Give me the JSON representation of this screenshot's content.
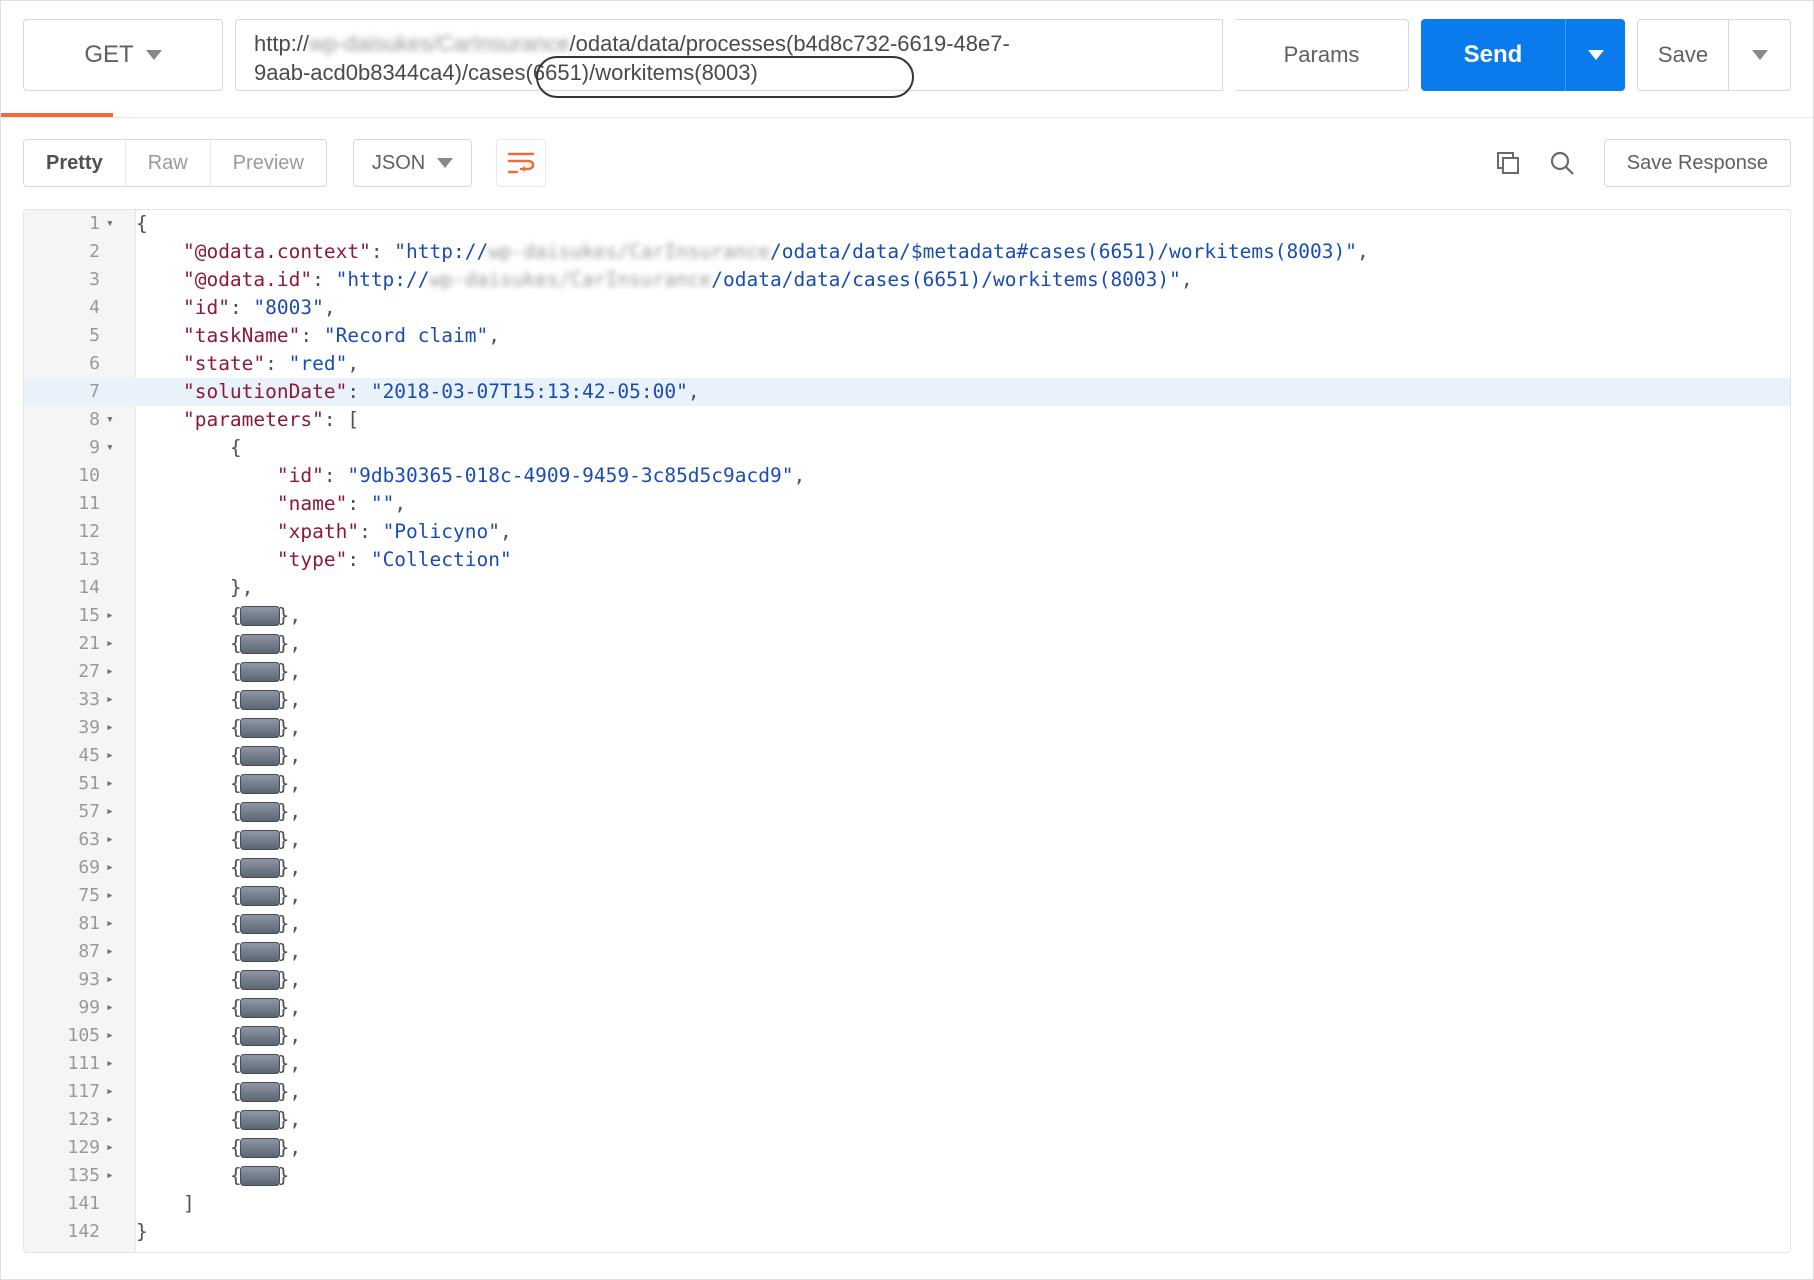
{
  "request": {
    "method": "GET",
    "url_line1_prefix": "http://",
    "url_line1_blurred": "wp-daisukes/CarInsurance",
    "url_line1_suffix": "/odata/data/processes(b4d8c732-6619-48e7-",
    "url_line2": "9aab-acd0b8344ca4)/cases(6651)/workitems(8003)",
    "params_label": "Params",
    "send_label": "Send",
    "save_label": "Save"
  },
  "response_bar": {
    "tab_pretty": "Pretty",
    "tab_raw": "Raw",
    "tab_preview": "Preview",
    "format": "JSON",
    "save_response": "Save Response"
  },
  "code": {
    "brace_open": "{",
    "brace_close": "}",
    "bracket_close": "]",
    "pad4": "    ",
    "pad8": "        ",
    "l2_key": "\"@odata.context\"",
    "l2_sep": ": ",
    "l2_q1": "\"http://",
    "l2_blur": "wp-daisukes/CarInsurance",
    "l2_q2": "/odata/data/$metadata#cases(6651)/workitems(8003)\"",
    "l3_key": "\"@odata.id\"",
    "l3_q2": "/odata/data/cases(6651)/workitems(8003)\"",
    "l4_key": "\"id\"",
    "l4_val": "\"8003\"",
    "l5_key": "\"taskName\"",
    "l5_val": "\"Record claim\"",
    "l6_key": "\"state\"",
    "l6_val": "\"red\"",
    "l7_key": "\"solutionDate\"",
    "l7_val": "\"2018-03-07T15:13:42-05:00\"",
    "l8_key": "\"parameters\"",
    "l8_val": ": [",
    "obj_open": "{",
    "p_id_key": "\"id\"",
    "p_id_val": "\"9db30365-018c-4909-9459-3c85d5c9acd9\"",
    "p_name_key": "\"name\"",
    "p_name_val": "\"\"",
    "p_xpath_key": "\"xpath\"",
    "p_xpath_val": "\"Policyno\"",
    "p_type_key": "\"type\"",
    "p_type_val": "\"Collection\"",
    "obj_close_comma": "},",
    "folded_lines": [
      "15",
      "21",
      "27",
      "33",
      "39",
      "45",
      "51",
      "57",
      "63",
      "69",
      "75",
      "81",
      "87",
      "93",
      "99",
      "105",
      "111",
      "117",
      "123",
      "129",
      "135"
    ],
    "line141": "141",
    "line142": "142"
  },
  "ln": {
    "n1": "1",
    "n2": "2",
    "n3": "3",
    "n4": "4",
    "n5": "5",
    "n6": "6",
    "n7": "7",
    "n8": "8",
    "n9": "9",
    "n10": "10",
    "n11": "11",
    "n12": "12",
    "n13": "13",
    "n14": "14"
  }
}
